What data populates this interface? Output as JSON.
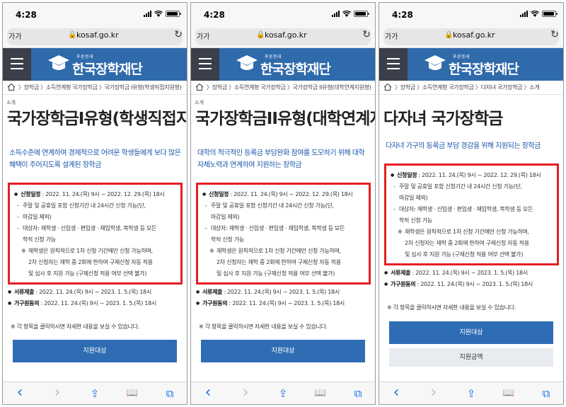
{
  "status": {
    "time": "4:28"
  },
  "browser": {
    "aa": "가가",
    "domain": "kosaf.go.kr",
    "lock": "🔒",
    "reload": "↻"
  },
  "site": {
    "logo_sub": "푸른등대",
    "logo_text": "한국장학재단"
  },
  "common": {
    "schedule": {
      "heading": "신청일정",
      "line": " : 2022. 11. 24.(목) 9시 ~ 2022. 12. 29.(목) 18시",
      "sub1a": "주말 및 공휴일 포함 신청기간 내 24시간 신청 가능(단,",
      "sub1b": "마감일 제외)",
      "sub2a": "대상자: 재학생 · 신입생 · 편입생 · 재입학생, 복학생 등 모든",
      "sub2b": "학적 신청 가능",
      "note_a": "재학생은 원칙적으로 1차 신청 기간에만 신청 가능하며,",
      "note_b": "2차 신청자는 재학 중 2회에 한하여 구제신청 자동 적용",
      "note_c": "및 심사 후 지원 가능 (구제신청 적용 여부 선택 불가)"
    },
    "documents": {
      "heading": "서류제출",
      "line": " : 2022. 11. 24.(목) 9시 ~ 2023. 1. 5.(목) 18시"
    },
    "consent": {
      "heading": "가구원동의",
      "line": " : 2022. 11. 24.(목) 9시 ~ 2023. 1. 5.(목) 18시"
    },
    "tip": "※ 각 항목을 클릭하시면 자세한 내용을 보실 수 있습니다.",
    "support_target": "지원대상",
    "support_amount": "지원금액"
  },
  "phones": [
    {
      "breadcrumb": "〉장학금 〉소득연계형 국가장학금 〉국가장학금 I유형(학생직접지원형)",
      "intro": "소개",
      "title": "국가장학금I유형(학생직접지원",
      "desc": "소득수준에 연계하여 경제적으로 어려운 학생들에게 보다 많은 혜택이 주어지도록 설계된 장학금"
    },
    {
      "breadcrumb": "〉장학금 〉소득연계형 국가장학금 〉국가장학금 II유형(대학연계지원형)",
      "intro": "소개",
      "title": "국가장학금II유형(대학연계지원",
      "desc": "대학의 적극적인 등록금 부담완화 참여를 도모하기 위해 대학 자체노력과 연계하여 지원하는 장학금"
    },
    {
      "breadcrumb": "〉장학금 〉소득연계형 국가장학금 〉다자녀 국가장학금 〉소개",
      "intro": "",
      "title": "다자녀 국가장학금",
      "desc": "다자녀 가구의 등록금 부담 경감을 위해 지원되는 장학금"
    }
  ],
  "toolbar": {
    "back": "‹",
    "forward": "›",
    "share": "⇪",
    "bookmarks": "📖",
    "tabs": "⧉"
  },
  "colors": {
    "header": "#2f6aab",
    "highlight": "#e51e25",
    "accent_text": "#1a55a8",
    "button": "#2e6db4"
  }
}
